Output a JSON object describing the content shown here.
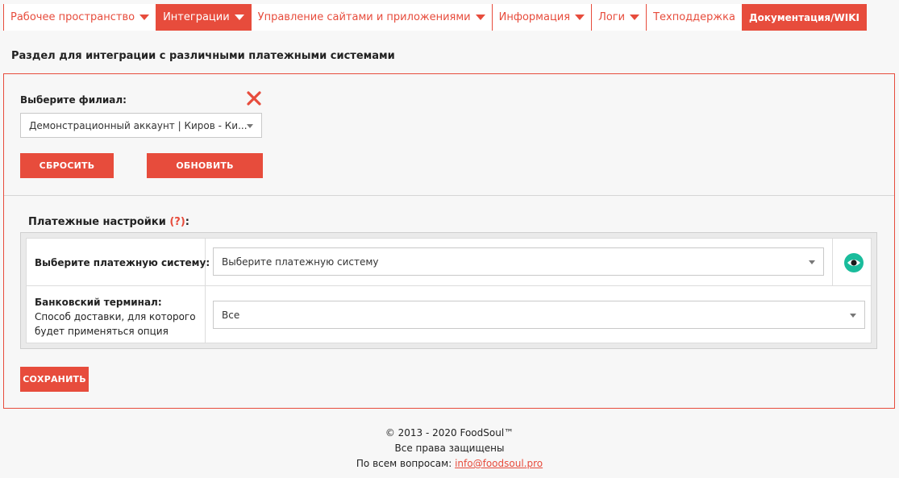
{
  "nav": {
    "items": [
      {
        "label": "Рабочее пространство"
      },
      {
        "label": "Интеграции"
      },
      {
        "label": "Управление сайтами и приложениями"
      },
      {
        "label": "Информация"
      },
      {
        "label": "Логи"
      },
      {
        "label": "Техподдержка"
      },
      {
        "label": "Документация/WIKI"
      }
    ]
  },
  "page": {
    "title": "Раздел для интеграции с различными платежными системами"
  },
  "branch": {
    "label": "Выберите филиал:",
    "selected": "Демонстрационный аккаунт | Киров - Ки...",
    "reset_label": "СБРОСИТЬ",
    "refresh_label": "ОБНОВИТЬ"
  },
  "payment": {
    "title": "Платежные настройки",
    "help": "(?)",
    "title_suffix": ":",
    "system_label": "Выберите платежную систему:",
    "system_selected": "Выберите платежную систему",
    "terminal_label": "Банковский терминал:",
    "terminal_desc_line1": "Способ доставки, для которого",
    "terminal_desc_line2": "будет применяться опция",
    "terminal_selected": "Все",
    "save_label": "СОХРАНИТЬ"
  },
  "footer": {
    "copyright": "© 2013 - 2020 FoodSoul™",
    "rights": "Все права защищены",
    "contact_prefix": "По всем вопросам:",
    "email": "info@foodsoul.pro"
  },
  "colors": {
    "accent": "#e74c3c",
    "eye": "#1abc9c"
  }
}
